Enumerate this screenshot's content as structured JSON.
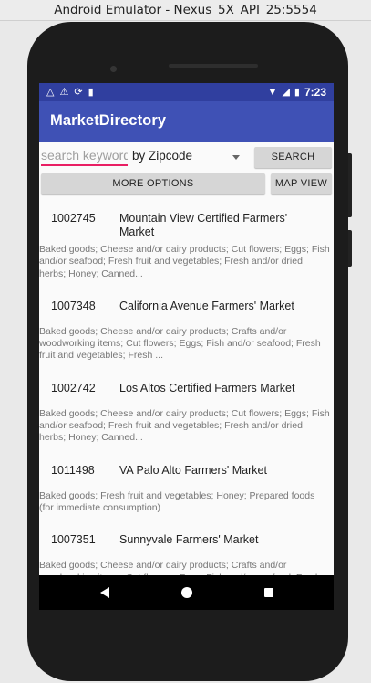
{
  "window": {
    "title": "Android Emulator - Nexus_5X_API_25:5554"
  },
  "status_bar": {
    "time": "7:23"
  },
  "app_bar": {
    "title": "MarketDirectory"
  },
  "search": {
    "placeholder": "search keywords",
    "filter_selected": "by Zipcode",
    "search_label": "SEARCH"
  },
  "buttons": {
    "more_options": "MORE OPTIONS",
    "map_view": "MAP VIEW"
  },
  "markets": [
    {
      "id": "1002745",
      "name": "Mountain View Certified Farmers' Market",
      "products": "Baked goods; Cheese and/or dairy products; Cut flowers; Eggs; Fish and/or seafood; Fresh fruit and vegetables; Fresh and/or dried herbs; Honey; Canned..."
    },
    {
      "id": "1007348",
      "name": "California Avenue Farmers' Market",
      "products": "Baked goods; Cheese and/or dairy products; Crafts and/or woodworking items; Cut flowers; Eggs; Fish and/or seafood; Fresh fruit and vegetables; Fresh ..."
    },
    {
      "id": "1002742",
      "name": "Los Altos Certified Farmers Market",
      "products": "Baked goods; Cheese and/or dairy products; Cut flowers; Eggs; Fish and/or seafood; Fresh fruit and vegetables; Fresh and/or dried herbs; Honey; Canned..."
    },
    {
      "id": "1011498",
      "name": "VA Palo Alto Farmers' Market",
      "products": "Baked goods; Fresh fruit and vegetables; Honey; Prepared foods (for immediate consumption)"
    },
    {
      "id": "1007351",
      "name": "Sunnyvale Farmers' Market",
      "products": "Baked goods; Cheese and/or dairy products; Crafts and/or woodworking items; Cut flowers; Eggs; Fish and/or seafood; Fresh fruit and vegetables; Fresh ..."
    }
  ]
}
